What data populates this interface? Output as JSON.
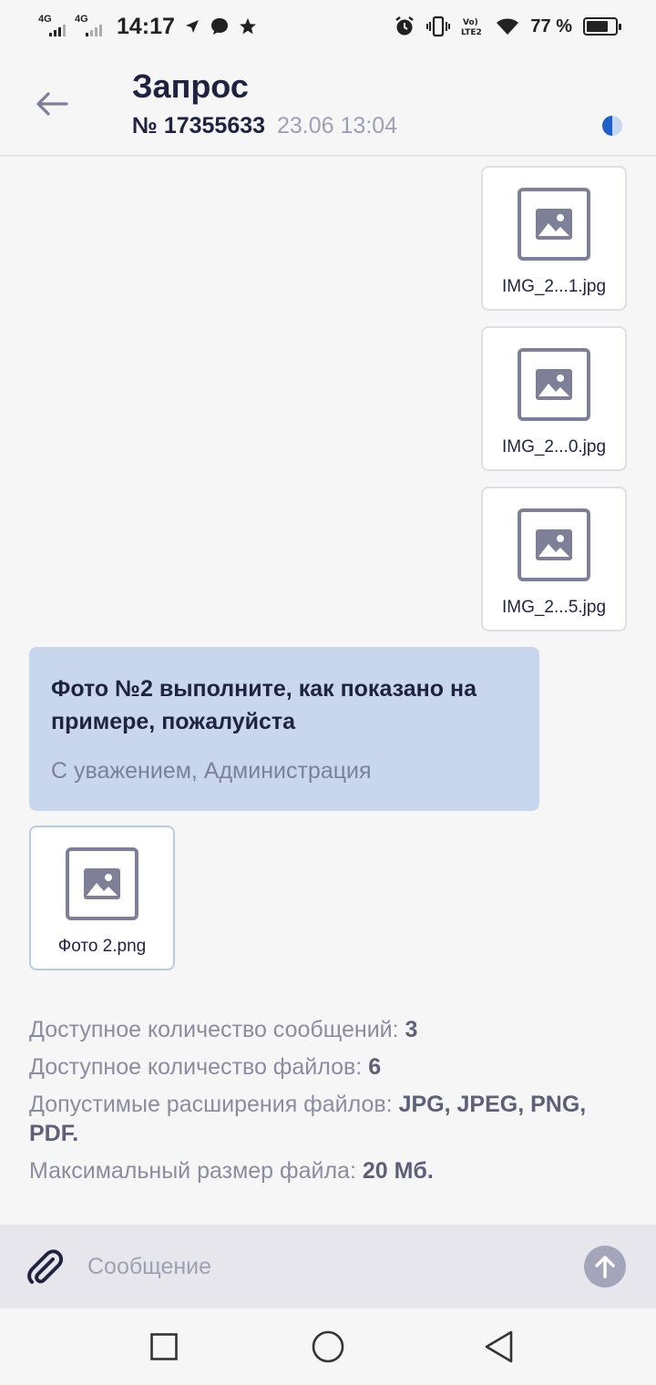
{
  "status_bar": {
    "net1": "4G",
    "net2": "4G",
    "time": "14:17",
    "battery_text": "77 %",
    "battery_level": 0.77
  },
  "header": {
    "title": "Запрос",
    "request_number": "№ 17355633",
    "request_date": "23.06 13:04"
  },
  "user_files": [
    {
      "name": "IMG_2...1.jpg"
    },
    {
      "name": "IMG_2...0.jpg"
    },
    {
      "name": "IMG_2...5.jpg"
    }
  ],
  "admin_message": {
    "text": "Фото №2 выполните, как показано на примере, пожалуйста",
    "signature": "С уважением, Администрация"
  },
  "admin_file": {
    "name": "Фото 2.png"
  },
  "limits": {
    "messages_label": "Доступное количество сообщений:",
    "messages_value": "3",
    "files_label": "Доступное количество файлов:",
    "files_value": "6",
    "extensions_label": "Допустимые расширения файлов:",
    "extensions_value": "JPG, JPEG, PNG, PDF.",
    "max_size_label": "Максимальный размер файла:",
    "max_size_value": "20 Мб."
  },
  "composer": {
    "placeholder": "Сообщение"
  },
  "colors": {
    "accent": "#1f5fc9",
    "bubble": "#c8d7ee",
    "text_dark": "#1f2340"
  }
}
